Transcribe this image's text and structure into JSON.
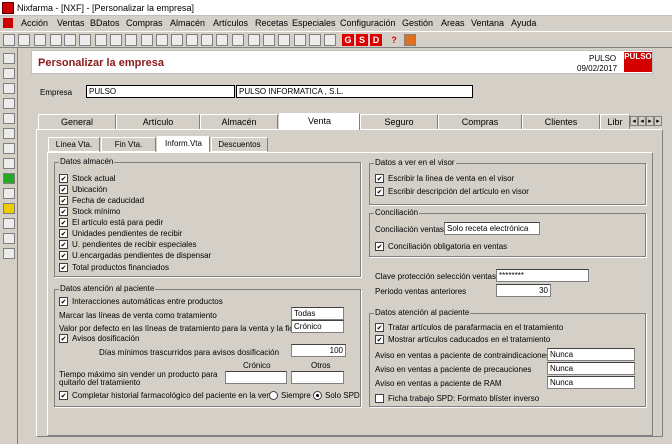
{
  "window": {
    "title": "Nixfarma - [NXF] - [Personalizar la empresa]"
  },
  "menu": [
    "Acción",
    "Ventas",
    "BDatos",
    "Compras",
    "Almacén",
    "Artículos",
    "Recetas",
    "Especiales",
    "Configuración",
    "Gestión",
    "Areas",
    "Ventana",
    "Ayuda"
  ],
  "toolbar": {
    "red_buttons": [
      "G",
      "S",
      "D"
    ],
    "help": "?"
  },
  "header": {
    "title": "Personalizar la empresa",
    "brand": "PULSO",
    "date": "09/02/2017",
    "logo": "PULSO"
  },
  "empresa": {
    "label": "Empresa",
    "code": "PULSO",
    "name": "PULSO INFORMATICA , S.L."
  },
  "tabs": [
    "General",
    "Artículo",
    "Almacén",
    "Venta",
    "Seguro",
    "Compras",
    "Clientes",
    "Libr"
  ],
  "subtabs": [
    "Línea Vta.",
    "Fin Vta.",
    "Inform.Vta",
    "Descuentos"
  ],
  "almacen": {
    "title": "Datos almacén",
    "items": [
      "Stock actual",
      "Ubicación",
      "Fecha de caducidad",
      "Stock mínimo",
      "El artículo está para pedir",
      "Unidades pendientes de recibir",
      "U. pendientes de recibir especiales",
      "U.encargadas pendientes de dispensar",
      "Total productos financiados"
    ]
  },
  "atencion": {
    "title": "Datos atención al paciente",
    "interacciones": "Interacciones automáticas entre productos",
    "marcar_label": "Marcar las líneas de venta como tratamiento",
    "marcar_value": "Todas",
    "valor_label": "Valor por defecto en las líneas de tratamiento para la venta y la ficha",
    "valor_value": "Crónico",
    "avisos": "Avisos dosificación",
    "dias_label": "Días mínimos trascurridos para avisos dosificación",
    "dias_value": "100",
    "cronico_label": "Crónico",
    "otros_label": "Otros",
    "tiempo_label1": "Tiempo máximo sin vender un producto para",
    "tiempo_label2": "quitarlo del tratamiento",
    "completar": "Completar historial farmacológico del paciente en la venta",
    "siempre": "Siempre",
    "solo_spd": "Solo SPD"
  },
  "visor": {
    "title": "Datos a ver en el visor",
    "items": [
      "Escribir la línea de venta en el visor",
      "Escribir descripción del artículo en visor"
    ]
  },
  "conciliacion": {
    "title": "Conciliación",
    "ventas_label": "Conciliación ventas",
    "ventas_value": "Solo receta electrónica",
    "obligatoria": "Conciliación obligatoria en ventas"
  },
  "clave": {
    "label": "Clave protección selección ventas",
    "value": "********"
  },
  "periodo": {
    "label": "Periodo ventas anteriores",
    "value": "30"
  },
  "atencion2": {
    "title": "Datos atención al paciente",
    "tratar": "Tratar artículos de parafarmacia en el tratamiento",
    "mostrar": "Mostrar artículos caducados en el tratamiento",
    "contra_label": "Aviso en ventas a paciente de contraindicaciones",
    "contra_value": "Nunca",
    "prec_label": "Aviso en ventas a paciente de precauciones",
    "prec_value": "Nunca",
    "ram_label": "Aviso en ventas a paciente de RAM",
    "ram_value": "Nunca",
    "ficha": "Ficha trabajo SPD: Formato blíster inverso"
  }
}
